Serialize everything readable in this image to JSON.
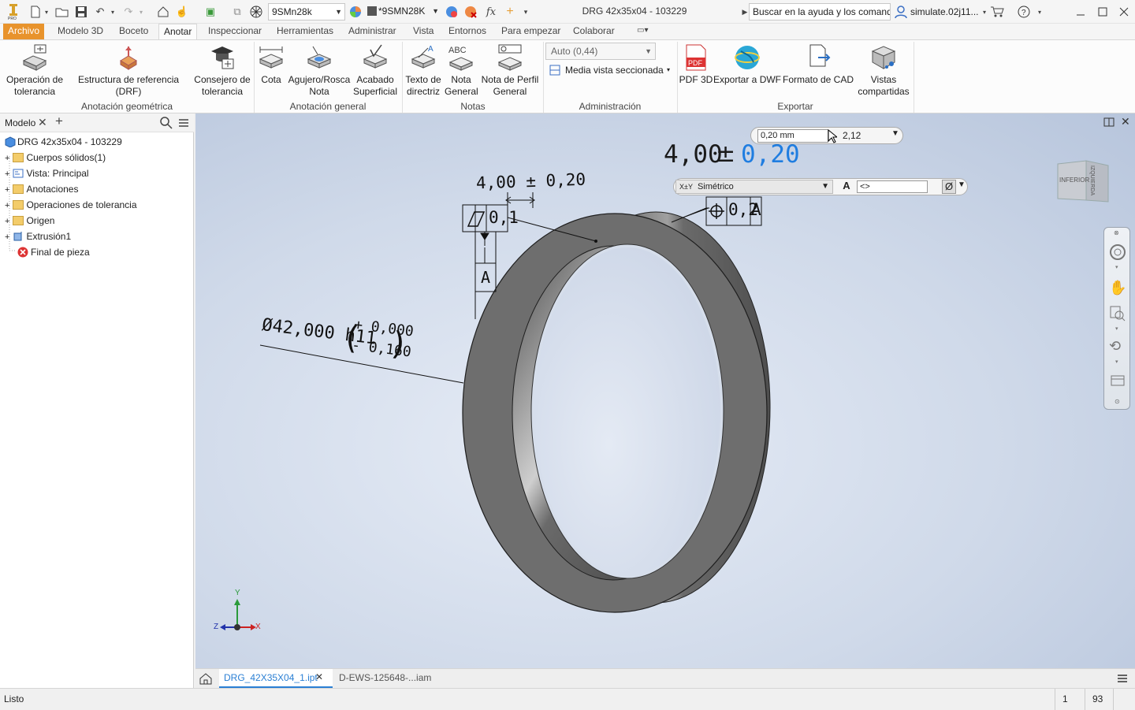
{
  "app": {
    "title": "DRG 42x35x04  -  103229",
    "help_search": "Buscar en la ayuda y los comandos",
    "user": "simulate.02j11..."
  },
  "toolbar": {
    "material": "9SMn28k",
    "appearance": "*9SMN28K"
  },
  "menu": [
    "Archivo",
    "Modelo 3D",
    "Boceto",
    "Anotar",
    "Inspeccionar",
    "Herramientas",
    "Administrar",
    "Vista",
    "Entornos",
    "Para empezar",
    "Colaborar"
  ],
  "ribbon": {
    "geo": {
      "label": "Anotación geométrica",
      "b1": "Operación de\ntolerancia",
      "b2": "Estructura de referencia (DRF)",
      "b3": "Consejero de\ntolerancia"
    },
    "gen": {
      "label": "Anotación general",
      "b1": "Cota",
      "b2": "Agujero/Rosca\nNota",
      "b3": "Acabado\nSuperficial"
    },
    "notes": {
      "label": "Notas",
      "b1": "Texto de\ndirectriz",
      "b2": "Nota\nGeneral",
      "b3": "Nota de Perfil\nGeneral"
    },
    "admin": {
      "label": "Administración",
      "scale": "Auto (0,44)",
      "section": "Media vista seccionada"
    },
    "export": {
      "label": "Exportar",
      "b1": "PDF 3D",
      "b2": "Exportar a DWF",
      "b3": "Formato de CAD",
      "b4": "Vistas\ncompartidas"
    }
  },
  "browser": {
    "tab": "Modelo",
    "items": [
      {
        "label": "DRG 42x35x04  -  103229"
      },
      {
        "label": "Cuerpos sólidos(1)"
      },
      {
        "label": "Vista: Principal"
      },
      {
        "label": "Anotaciones"
      },
      {
        "label": "Operaciones de tolerancia"
      },
      {
        "label": "Origen"
      },
      {
        "label": "Extrusión1"
      },
      {
        "label": "Final de pieza"
      }
    ]
  },
  "annotations": {
    "dim_small": "4,00 ± 0,20",
    "flatness_value": "0,1",
    "datum": "A",
    "position_value": "0,2",
    "position_datum": "A",
    "dia_main": "Ø42,000 h11",
    "dia_upper": "+ 0,000",
    "dia_lower": "- 0,160",
    "edit_nominal": "4,00",
    "edit_pm": "±",
    "edit_tol": "0,20",
    "tol_input": "0,20 mm",
    "tol_precision": "2,12",
    "tol_type": "Simétrico",
    "tol_type_prefix": "X±Y",
    "text_field": "<>"
  },
  "viewcube": {
    "face1": "INFERIOR",
    "face2": "IZQUIERDA"
  },
  "triad": {
    "x": "X",
    "y": "Y",
    "z": "Z"
  },
  "doctabs": {
    "tab1": "DRG_42X35X04_1.ipt",
    "tab2": "D-EWS-125648-...iam"
  },
  "status": {
    "text": "Listo",
    "num1": "1",
    "num2": "93"
  }
}
